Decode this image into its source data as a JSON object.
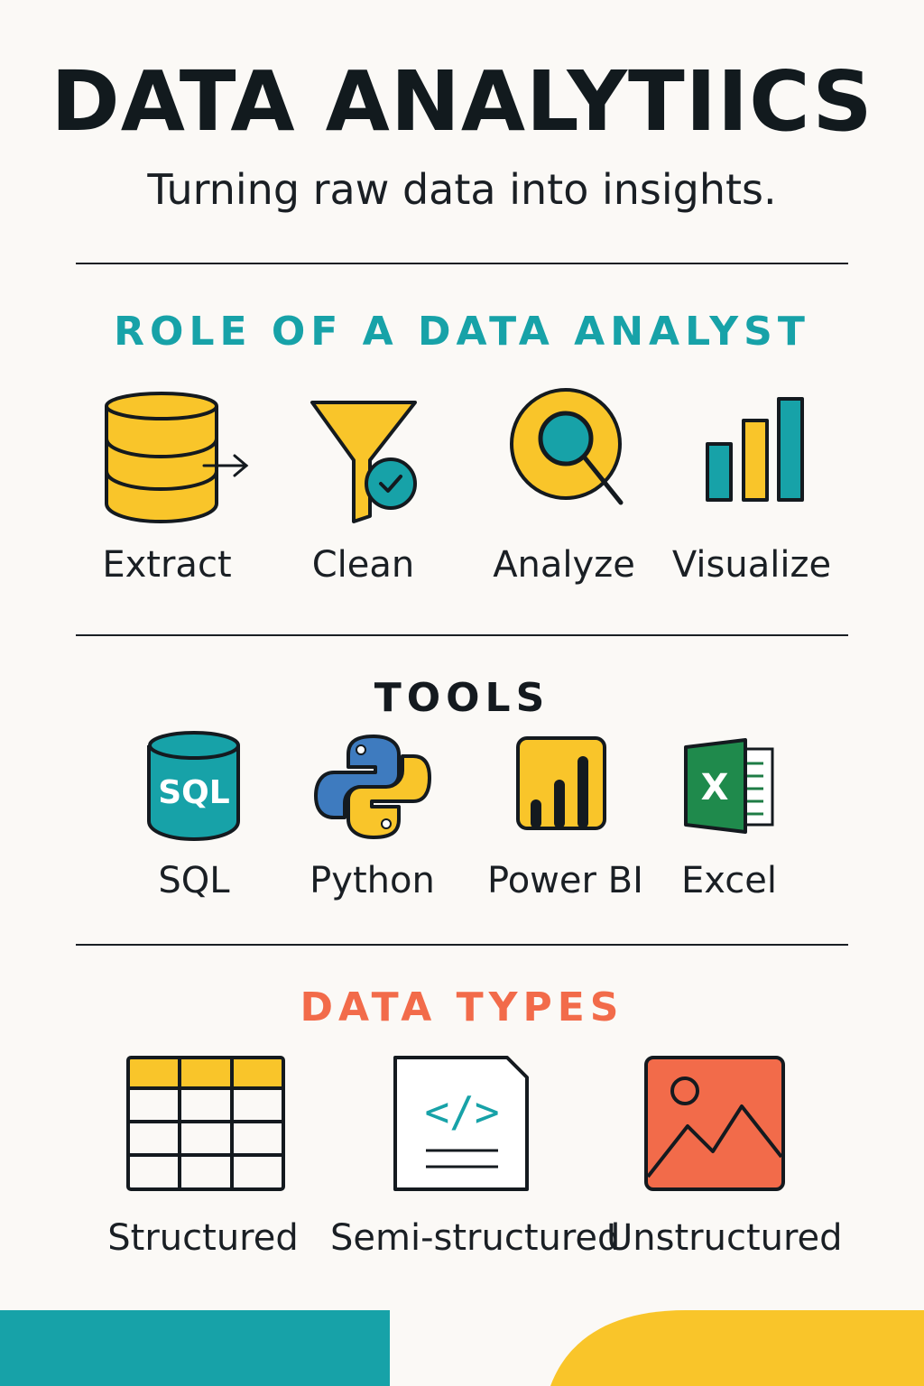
{
  "header": {
    "title": "DATA ANALYTIICS",
    "subtitle": "Turning raw data into insights."
  },
  "role_section": {
    "heading": "ROLE OF A DATA ANALYST",
    "items": [
      {
        "label": "Extract",
        "icon": "database-arrow-icon"
      },
      {
        "label": "Clean",
        "icon": "funnel-check-icon"
      },
      {
        "label": "Analyze",
        "icon": "magnifier-icon"
      },
      {
        "label": "Visualize",
        "icon": "bar-chart-icon"
      }
    ]
  },
  "tools_section": {
    "heading": "TOOLS",
    "items": [
      {
        "label": "SQL",
        "icon": "sql-database-icon",
        "icon_text": "SQL"
      },
      {
        "label": "Python",
        "icon": "python-logo-icon"
      },
      {
        "label": "Power BI",
        "icon": "power-bi-icon"
      },
      {
        "label": "Excel",
        "icon": "excel-icon",
        "icon_text": "X"
      }
    ]
  },
  "types_section": {
    "heading": "DATA TYPES",
    "items": [
      {
        "label": "Structured",
        "icon": "table-grid-icon"
      },
      {
        "label": "Semi-structured",
        "icon": "code-document-icon",
        "icon_text": "</>"
      },
      {
        "label": "Unstructured",
        "icon": "image-icon"
      }
    ]
  },
  "colors": {
    "background": "#fbf9f6",
    "teal": "#17a2a8",
    "yellow": "#f9c52a",
    "coral": "#f26b4a",
    "dark": "#141a1f"
  }
}
